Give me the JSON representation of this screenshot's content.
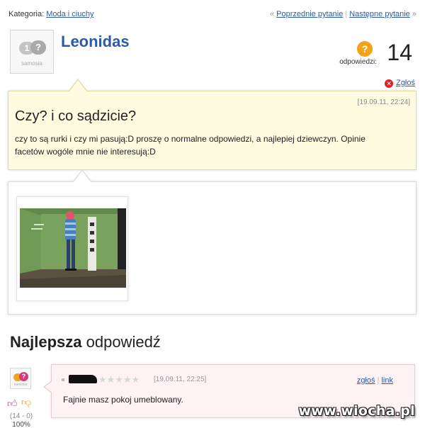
{
  "topbar": {
    "category_label": "Kategoria:",
    "category_link": "Moda i ciuchy",
    "prev_link": "Poprzednie pytanie",
    "next_link": "Następne pytanie"
  },
  "asker": {
    "avatar_brand": "samosia",
    "username": "Leonidas"
  },
  "answers_counter": {
    "label": "odpowiedzi:",
    "count": "14",
    "icon": "question-bubble-icon"
  },
  "report_label": "Zgłoś",
  "question": {
    "date": "[19.09.11, 22:24]",
    "title": "Czy? i co sądzicie?",
    "body": "czy to są rurki i czy mi pasują:D proszę o normalne odpowiedzi, a najlepiej dziewczyn. Opinie facetów wogóle mnie nie interesują:D"
  },
  "best_answer": {
    "heading_bold": "Najlepsza",
    "heading_rest": " odpowiedź",
    "avatar_brand": "samosia",
    "votes_counts": "(14 - 0)",
    "votes_percent": "100%",
    "stars": "★★★★★",
    "date": "[19.09.11, 22:25]",
    "report_link": "zgłoś",
    "link_label": "link",
    "text": "Fajnie masz pokoj umeblowany."
  },
  "watermark": "www.wiocha.pl",
  "colors": {
    "link": "#2b5aa8",
    "question_bg": "#fffbe0",
    "answer_bg": "#fff2f5",
    "accent_orange": "#f3a219"
  }
}
